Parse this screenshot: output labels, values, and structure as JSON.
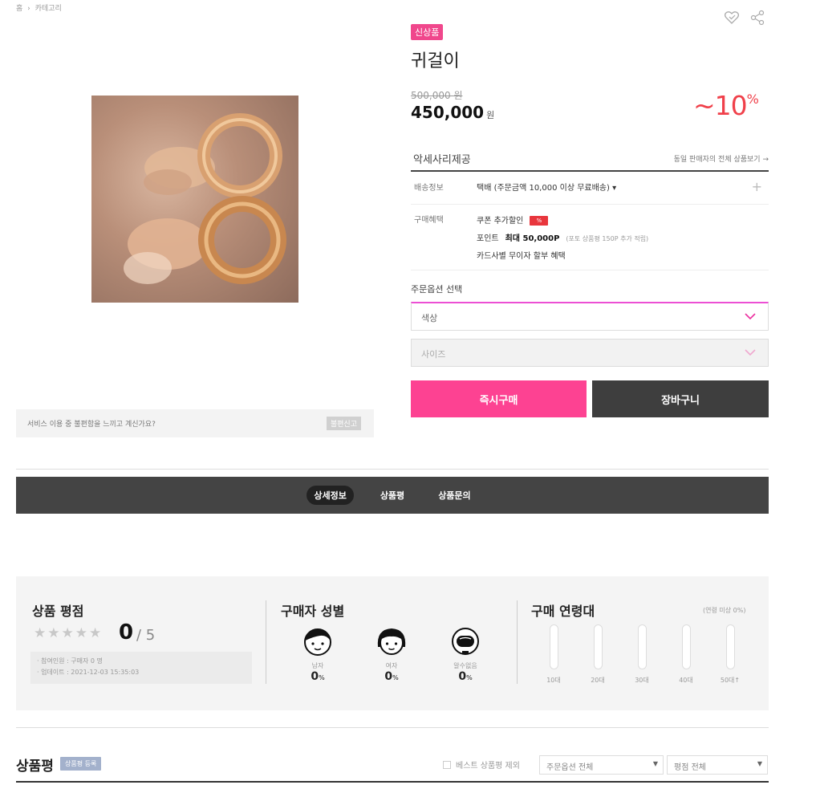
{
  "breadcrumb": {
    "home": "홈",
    "separator": "›",
    "category": "카테고리"
  },
  "product": {
    "badge": "신상품",
    "title": "귀걸이",
    "original_price": "500,000 원",
    "price": "450,000",
    "price_unit": "원",
    "discount": "~10",
    "discount_unit": "%"
  },
  "seller": {
    "name": "악세사리제공",
    "link": "동일 판매자의 전체 상품보기 →"
  },
  "shipping": {
    "label": "배송정보",
    "value": "택배 (주문금액 10,000 이상 무료배송) ▾",
    "plus": "+"
  },
  "benefit": {
    "label": "구매혜택",
    "coupon": "쿠폰 추가할인",
    "coupon_badge": "%",
    "point_label": "포인트",
    "point_value": "최대 50,000P",
    "point_note": "(포토 상품평 150P 추가 적립)",
    "card": "카드사별 무이자 할부 혜택"
  },
  "options": {
    "label": "주문옵션 선택",
    "color_placeholder": "색상",
    "size_placeholder": "사이즈"
  },
  "buttons": {
    "buy": "즉시구매",
    "cart": "장바구니"
  },
  "report": {
    "text": "서비스 이용 중 불편함을 느끼고 계신가요?",
    "button": "불편신고"
  },
  "tabs": [
    {
      "label": "상세정보",
      "active": true
    },
    {
      "label": "상품평",
      "active": false
    },
    {
      "label": "상품문의",
      "active": false
    }
  ],
  "rating": {
    "heading": "상품 평점",
    "score": "0",
    "max": "/ 5",
    "stars_filled": 0,
    "participants": "· 참여인원 : 구매자 0 명",
    "updated": "· 업데이트 : 2021-12-03 15:35:03"
  },
  "gender": {
    "heading": "구매자 성별",
    "items": [
      {
        "label": "남자",
        "value": "0",
        "unit": "%"
      },
      {
        "label": "여자",
        "value": "0",
        "unit": "%"
      },
      {
        "label": "알수없음",
        "value": "0",
        "unit": "%"
      }
    ]
  },
  "age": {
    "heading": "구매 연령대",
    "note": "(연령 미상 0%)",
    "groups": [
      {
        "label": "10대",
        "value": 0
      },
      {
        "label": "20대",
        "value": 0
      },
      {
        "label": "30대",
        "value": 0
      },
      {
        "label": "40대",
        "value": 0
      },
      {
        "label": "50대↑",
        "value": 0
      }
    ]
  },
  "reviews": {
    "title": "상품평",
    "badge": "상품평 등록",
    "best_exclude": "베스트 상품평 제외",
    "filter_option": "주문옵션 전체",
    "filter_rating": "평점 전체"
  },
  "colors": {
    "accent": "#fd4292",
    "dark": "#3e3e3e",
    "discount": "#f0404a",
    "badge": "#f0478c"
  }
}
